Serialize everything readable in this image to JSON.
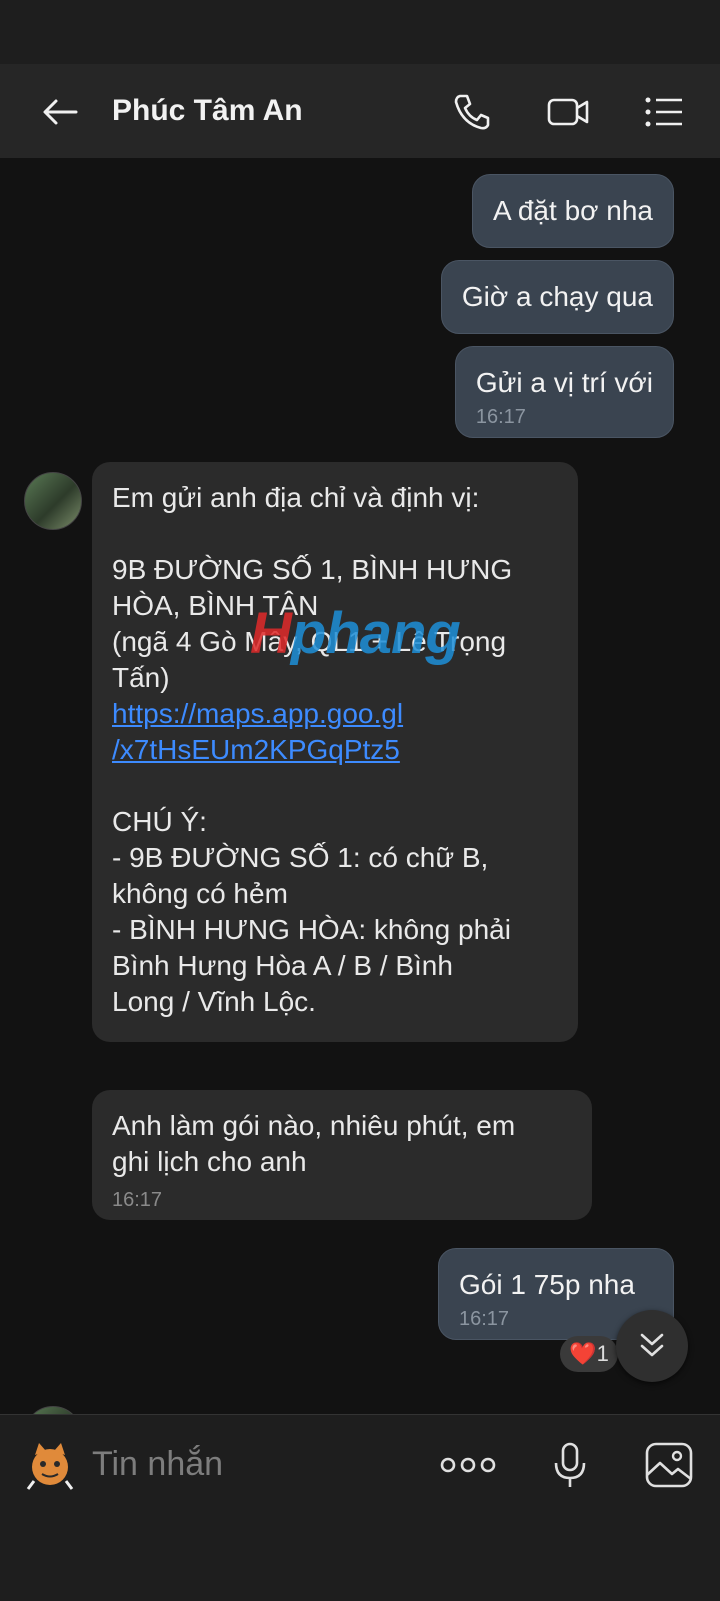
{
  "header": {
    "title": "Phúc Tâm An",
    "icons": [
      "back-arrow-icon",
      "phone-icon",
      "video-call-icon",
      "menu-list-icon"
    ]
  },
  "messages": [
    {
      "from": "me",
      "text": "A đặt bơ nha"
    },
    {
      "from": "me",
      "text": "Giờ a chạy qua"
    },
    {
      "from": "me",
      "text": "Gửi a vị trí với",
      "time": "16:17"
    },
    {
      "from": "contact",
      "lines": [
        "Em gửi anh địa chỉ và định vị:",
        "",
        "9B ĐƯỜNG SỐ 1, BÌNH HƯNG",
        "HÒA, BÌNH TÂN",
        "(ngã 4 Gò Mây, QL1 + Lê Trọng",
        "Tấn)"
      ],
      "link_line1": "https://maps.app.goo.gl",
      "link_line2": "/x7tHsEUm2KPGqPtz5",
      "lines_after": [
        "",
        "CHÚ Ý:",
        "- 9B ĐƯỜNG SỐ 1: có chữ B,",
        "không có hẻm",
        "- BÌNH HƯNG HÒA: không phải",
        "Bình Hưng Hòa A / B / Bình",
        "Long / Vĩnh Lộc."
      ]
    },
    {
      "from": "contact",
      "line1": "Anh làm gói nào, nhiêu phút, em",
      "line2": "ghi lịch cho anh",
      "time": "16:17"
    },
    {
      "from": "me",
      "text": "Gói 1 75p nha",
      "time": "16:17",
      "reaction": {
        "emoji": "❤️",
        "count": "1"
      }
    }
  ],
  "watermark": {
    "part1": "H",
    "part2": "phang"
  },
  "input": {
    "placeholder": "Tin nhắn"
  },
  "colors": {
    "background": "#121212",
    "outgoing_bubble": "#3a4450",
    "incoming_bubble": "#2b2b2b",
    "link": "#3d8bff"
  }
}
